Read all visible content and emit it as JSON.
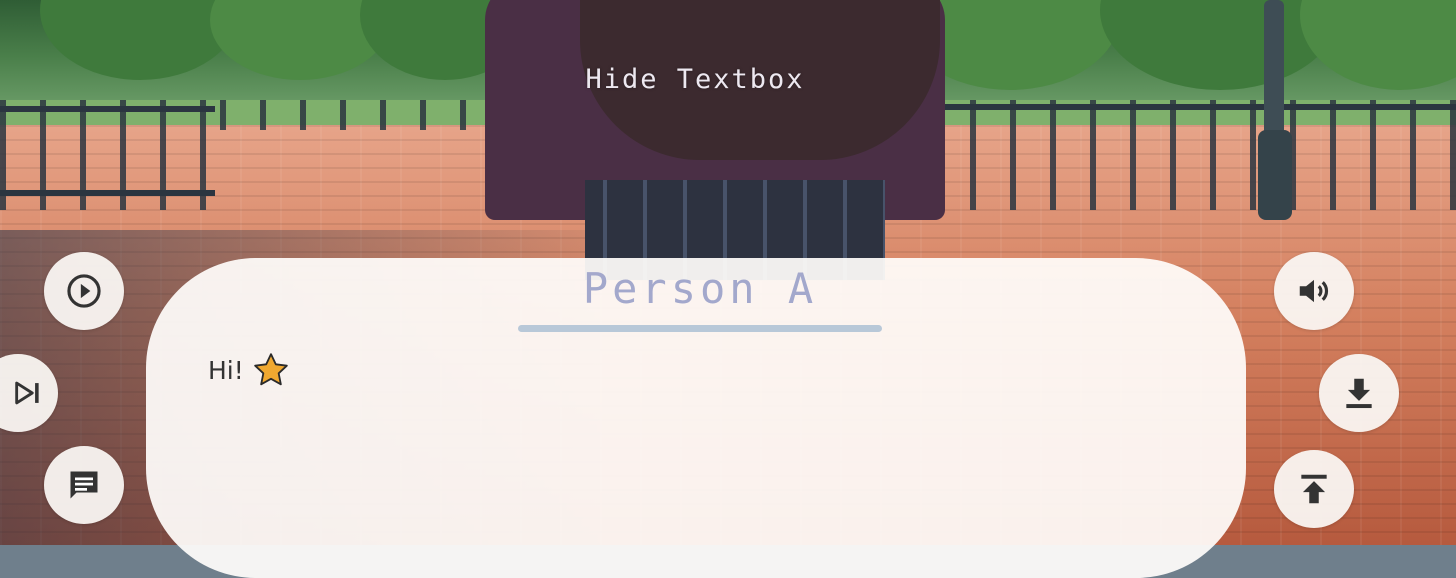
{
  "overlay": {
    "hide_textbox_label": "Hide Textbox"
  },
  "dialogue": {
    "speaker": "Person A",
    "text": "Hi!",
    "emoji_icon": "star-icon"
  },
  "controls": {
    "left": [
      "play-icon",
      "skip-icon",
      "message-log-icon"
    ],
    "right": [
      "volume-icon",
      "download-icon",
      "upload-icon"
    ]
  },
  "colors": {
    "speaker_name": "#a3a8cc",
    "speaker_underline": "#b8c8d8",
    "textbox_bg": "#fffdfb",
    "star": "#f0a830"
  }
}
